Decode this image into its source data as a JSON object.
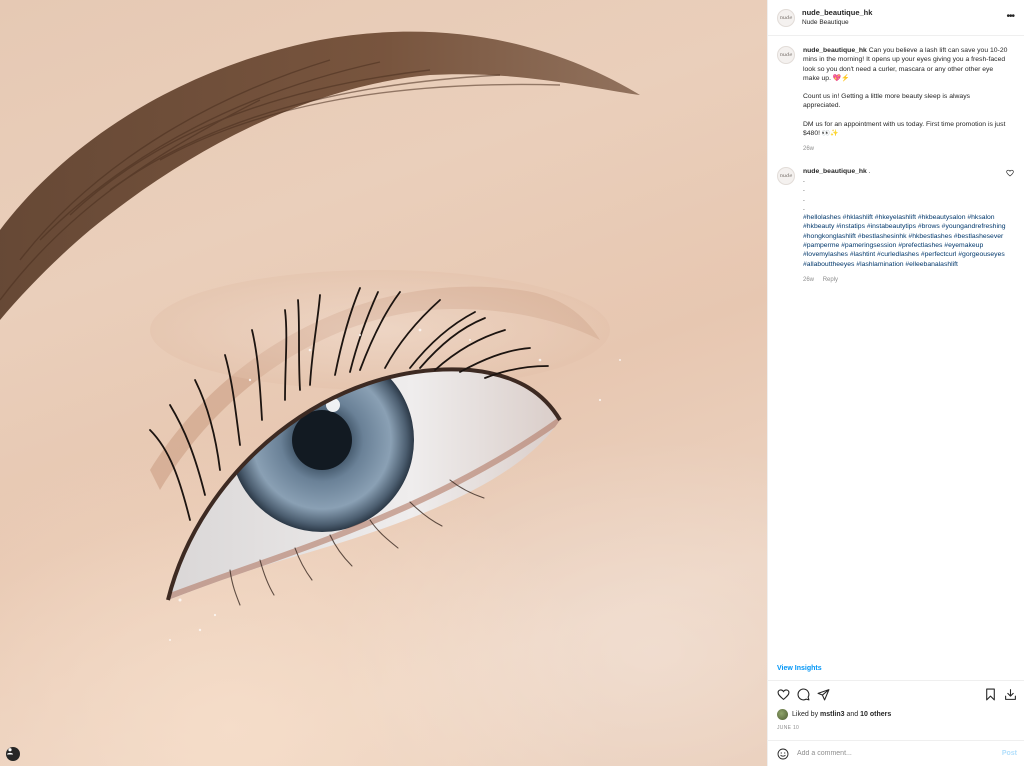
{
  "post": {
    "username": "nude_beautique_hk",
    "location": "Nude Beautique",
    "avatar_text": "nude"
  },
  "caption": {
    "username": "nude_beautique_hk",
    "p1": "Can you believe a lash lift can save you 10-20 mins in the morning! It opens up your eyes giving you a fresh-faced look so you don't need a curler, mascara or any other other eye make up. 💖⚡",
    "p2": "Count us in! Getting a little more beauty sleep is always appreciated.",
    "p3": "DM us for an appointment with us today. First time promotion is just $480! 👀✨",
    "time": "26w"
  },
  "hashtag_comment": {
    "username": "nude_beautique_hk",
    "tail": ".",
    "dots": [
      ".",
      ".",
      ".",
      "."
    ],
    "hashtags": "#hellolashes #hklashlift #hkeyelashlift #hkbeautysalon #hksalon #hkbeauty #instatips #instabeautytips #brows #youngandrefreshing #hongkonglashlift #bestlashesinhk #hkbestlashes #bestlashesever #pamperme #pameringsession #prefectlashes #eyemakeup #lovemylashes #lashtint #curledlashes #perfectcurl #gorgeouseyes #allabouttheeyes #lashlamination #elleebanalashlift",
    "time": "26w",
    "reply_label": "Reply"
  },
  "insights_label": "View Insights",
  "likes": {
    "prefix": "Liked by",
    "user": "mstlin3",
    "and": "and",
    "others": "10 others"
  },
  "date": "JUNE 10",
  "comment_box": {
    "placeholder": "Add a comment...",
    "post_label": "Post"
  },
  "icons": [
    "more-icon",
    "heart-icon",
    "comment-icon",
    "share-icon",
    "bookmark-icon",
    "download-icon",
    "emoji-icon",
    "profile-icon"
  ],
  "colors": {
    "link": "#0095f6",
    "hashtag": "#00376b",
    "muted": "#8e8e8e",
    "post_disabled": "#b2dffc"
  }
}
